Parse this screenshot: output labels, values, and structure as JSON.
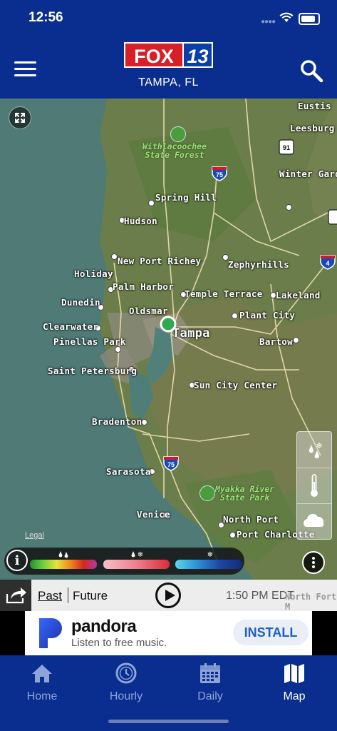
{
  "status_bar": {
    "time": "12:56"
  },
  "header": {
    "logo_left": "FOX",
    "logo_right": "13",
    "location": "TAMPA, FL"
  },
  "map": {
    "legal": "Legal",
    "places": {
      "eustis": "Eustis",
      "leesburg": "Leesburg",
      "winter_garden": "Winter Garde",
      "spring_hill": "Spring Hill",
      "hudson": "Hudson",
      "new_port_richey": "New Port Richey",
      "zephyrhills": "Zephyrhills",
      "holiday": "Holiday",
      "palm_harbor": "Palm Harbor",
      "temple_terrace": "Temple Terrace",
      "lakeland": "Lakeland",
      "dunedin": "Dunedin",
      "oldsmar": "Oldsmar",
      "plant_city": "Plant City",
      "clearwater": "Clearwater",
      "tampa": "Tampa",
      "pinellas_park": "Pinellas Park",
      "bartow": "Bartow",
      "saint_petersburg": "Saint Petersburg",
      "sun_city_center": "Sun City Center",
      "bradenton": "Bradenton",
      "sarasota": "Sarasota",
      "venice": "Venice",
      "north_port": "North Port",
      "port_charlotte": "Port Charlotte",
      "north_fort_m": "North Fort M"
    },
    "parks": {
      "withlacoochee": "Withlacoochee\nState Forest",
      "myakka": "Myakka River\nState Park"
    },
    "shields": {
      "i75_north": "75",
      "i75_south": "75",
      "i4": "4",
      "us91": "91"
    }
  },
  "timeline": {
    "past": "Past",
    "future": "Future",
    "time": "1:50 PM EDT"
  },
  "ad": {
    "brand": "pandora",
    "tagline": "Listen to free music.",
    "cta": "INSTALL"
  },
  "tabs": [
    {
      "label": "Home",
      "icon": "home-icon"
    },
    {
      "label": "Hourly",
      "icon": "clock-icon"
    },
    {
      "label": "Daily",
      "icon": "calendar-icon"
    },
    {
      "label": "Map",
      "icon": "map-icon"
    }
  ],
  "colors": {
    "brand_blue": "#0a2e8f",
    "fox_red": "#d61f26"
  }
}
